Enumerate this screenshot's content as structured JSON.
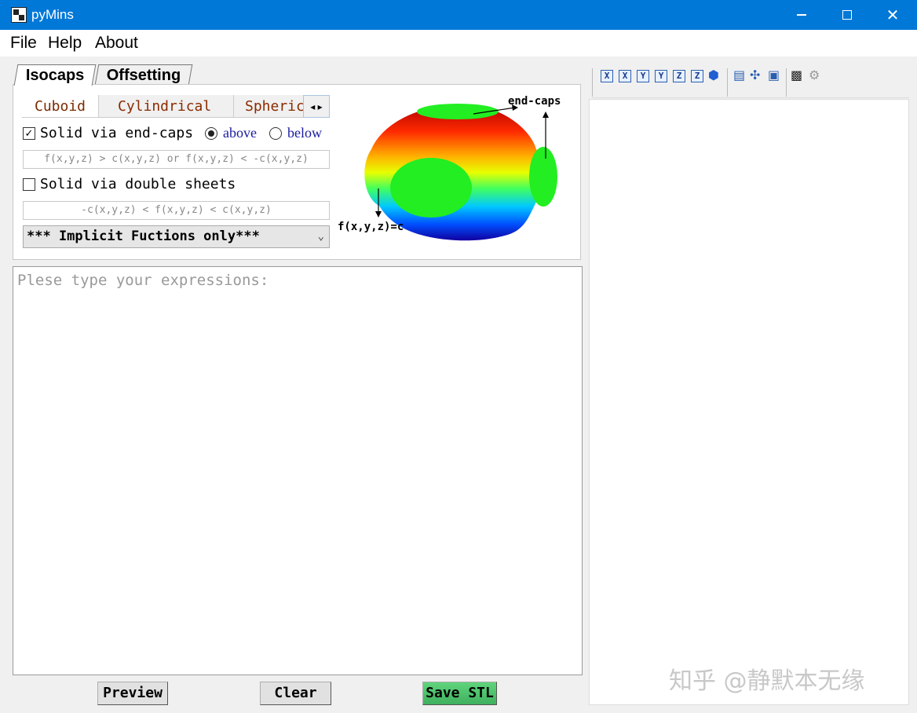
{
  "window": {
    "title": "pyMins",
    "minimize_glyph": "",
    "close_glyph": "✕"
  },
  "menu": [
    "File",
    "Help",
    "About"
  ],
  "outer_tabs": [
    "Isocaps",
    "Offsetting"
  ],
  "inner_tabs": [
    "Cuboid",
    "Cylindrical",
    "Spherical"
  ],
  "tab_scroll_arrows": "◂ ▸",
  "options": {
    "end_caps_label": "Solid via end-caps",
    "end_caps_checked": true,
    "above_label": "above",
    "below_label": "below",
    "selected_side": "above",
    "end_caps_formula": "f(x,y,z) > c(x,y,z) or f(x,y,z) < -c(x,y,z)",
    "double_sheets_label": "Solid via double sheets",
    "double_sheets_checked": false,
    "double_sheets_formula": "-c(x,y,z) < f(x,y,z) < c(x,y,z)"
  },
  "function_type": {
    "selected": "*** Implicit Fuctions only***"
  },
  "illustration": {
    "caps_label": "end-caps",
    "surface_label": "f(x,y,z)=c"
  },
  "editor": {
    "placeholder": "Plese type your expressions:",
    "value": ""
  },
  "buttons": {
    "preview": "Preview",
    "clear": "Clear",
    "save": "Save STL"
  },
  "toolbar_icons": [
    "x-view-icon",
    "x-reverse-view-icon",
    "y-view-icon",
    "y-reverse-view-icon",
    "z-view-icon",
    "z-reverse-view-icon",
    "iso-cube-icon",
    "layers-icon",
    "axes-icon",
    "fit-view-icon",
    "save-icon",
    "settings-gear-icon"
  ],
  "toolbar_letters": [
    "X",
    "X",
    "Y",
    "Y",
    "Z",
    "Z"
  ],
  "watermark": "知乎 @静默本无缘"
}
